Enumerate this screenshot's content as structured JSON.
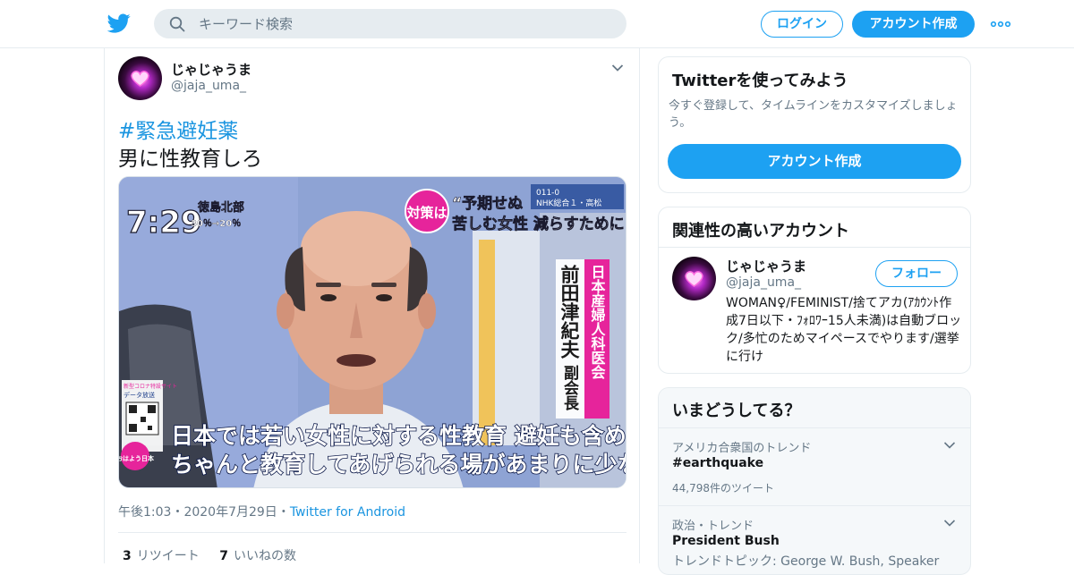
{
  "header": {
    "search_placeholder": "キーワード検索",
    "login_label": "ログイン",
    "signup_label": "アカウント作成",
    "brand_color": "#1da1f2"
  },
  "tweet": {
    "author_name": "じゃじゃうま",
    "author_handle": "@jaja_uma_",
    "hashtag": "#緊急避妊薬",
    "text": "男に性教育しろ",
    "time": "午後1:03",
    "separator": "・",
    "date": "2020年7月29日",
    "source": "Twitter for Android",
    "retweets_count": "3",
    "retweets_label": "リツイート",
    "likes_count": "7",
    "likes_label": "いいねの数",
    "media": {
      "clock": "7:29",
      "region": "徳島北部",
      "weather": "30％→20％",
      "badge": "対策は",
      "headline_1": "“予期せぬ",
      "headline_2": "苦しむ女性 減らすために",
      "channel_line_1": "011-0",
      "channel_line_2": "NHK総合１・高松",
      "org": "日本産婦人科医会",
      "person_name": "前田津紀夫",
      "person_title": "副会長",
      "caption_1": "日本では若い女性に対する性教育 避妊も含めて",
      "caption_2": "ちゃんと教育してあげられる場があまりに少ない",
      "side_1": "新型コロナ特設サイト",
      "side_2": "データ放送",
      "logo_text": "おはよう日本"
    }
  },
  "signup_card": {
    "title": "Twitterを使ってみよう",
    "subtitle": "今すぐ登録して、タイムラインをカスタマイズしましょう。",
    "button_label": "アカウント作成"
  },
  "related": {
    "title": "関連性の高いアカウント",
    "account_name": "じゃじゃうま",
    "account_handle": "@jaja_uma_",
    "follow_label": "フォロー",
    "bio": "WOMAN♀/FEMINIST/捨てアカ(ｱｶｳﾝﾄ作成7日以下・ﾌｫﾛﾜｰ15人未満)は自動ブロック/多忙のためマイペースでやります/選挙に行け"
  },
  "trends": {
    "title": "いまどうしてる？",
    "items": [
      {
        "context": "アメリカ合衆国のトレンド",
        "name": "#earthquake",
        "count": "44,798件のツイート"
      },
      {
        "context": "政治・トレンド",
        "name": "President Bush",
        "subtitle": "トレンドトピック: George W. Bush, Speaker"
      }
    ]
  }
}
